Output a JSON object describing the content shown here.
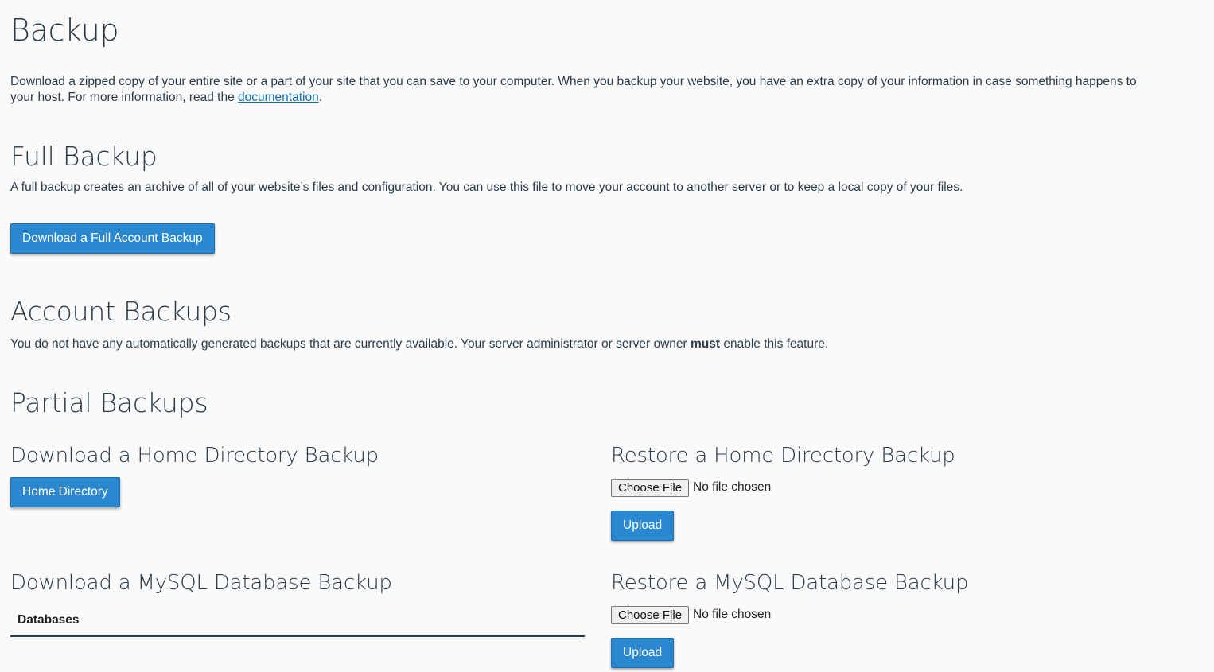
{
  "page": {
    "title": "Backup",
    "intro_before_link": "Download a zipped copy of your entire site or a part of your site that you can save to your computer. When you backup your website, you have an extra copy of your information in case something happens to your host. For more information, read the ",
    "intro_link": "documentation",
    "intro_after_link": "."
  },
  "full_backup": {
    "heading": "Full Backup",
    "description": "A full backup creates an archive of all of your website’s files and configuration. You can use this file to move your account to another server or to keep a local copy of your files.",
    "button_label": "Download a Full Account Backup"
  },
  "account_backups": {
    "heading": "Account Backups",
    "message_before": "You do not have any automatically generated backups that are currently available. Your server administrator or server owner ",
    "message_bold": "must",
    "message_after": " enable this feature."
  },
  "partial_backups": {
    "heading": "Partial Backups",
    "home_download": {
      "heading": "Download a Home Directory Backup",
      "button_label": "Home Directory"
    },
    "home_restore": {
      "heading": "Restore a Home Directory Backup",
      "choose_label": "Choose File",
      "file_status": "No file chosen",
      "upload_label": "Upload"
    },
    "mysql_download": {
      "heading": "Download a MySQL Database Backup",
      "table_header": "Databases"
    },
    "mysql_restore": {
      "heading": "Restore a MySQL Database Backup",
      "choose_label": "Choose File",
      "file_status": "No file chosen",
      "upload_label": "Upload"
    }
  },
  "colors": {
    "background": "#fafafa",
    "text": "#293a4a",
    "link": "#0d6fb5",
    "button": "#2a88d0"
  }
}
